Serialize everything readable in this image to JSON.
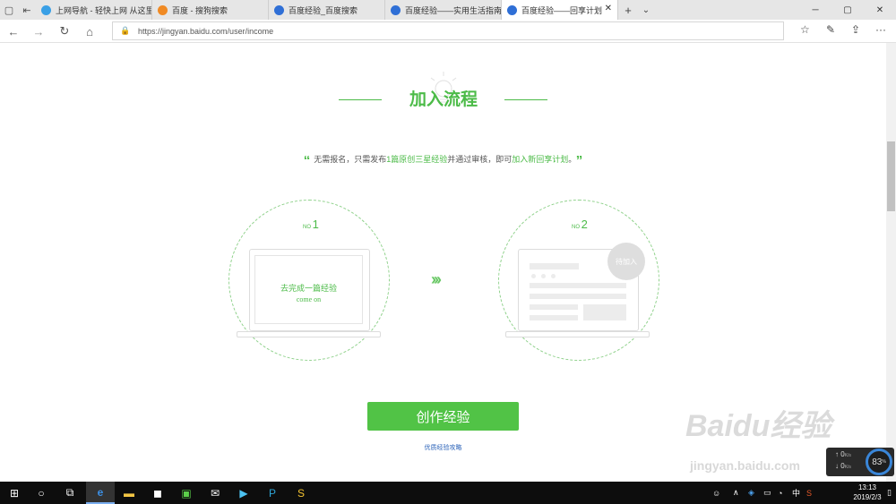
{
  "browser": {
    "tabs": [
      {
        "label": "上网导航 - 轻快上网 从这里",
        "fav": "#3aa0e6"
      },
      {
        "label": "百度 - 搜狗搜索",
        "fav": "#f08a24"
      },
      {
        "label": "百度经验_百度搜索",
        "fav": "#2f6fd6"
      },
      {
        "label": "百度经验——实用生活指南",
        "fav": "#2f6fd6"
      },
      {
        "label": "百度经验——回享计划",
        "fav": "#2f6fd6"
      }
    ],
    "url": "https://jingyan.baidu.com/user/income"
  },
  "page": {
    "section_title": "加入流程",
    "quote_pre": "无需报名，只需发布",
    "quote_hl1": "1篇原创三星经验",
    "quote_mid": "并通过审核，即可",
    "quote_hl2": "加入新回享计划",
    "quote_end": "。",
    "step1": {
      "no_prefix": "NO",
      "no": "1",
      "text": "去完成一篇经验",
      "sub": "come on"
    },
    "step2": {
      "no_prefix": "NO",
      "no": "2",
      "badge": "待加入"
    },
    "create_button": "创作经验",
    "guide_link": "优质经验攻略"
  },
  "watermark": {
    "logo": "Baidu经验",
    "url": "jingyan.baidu.com"
  },
  "net_widget": {
    "up": "0",
    "down": "0",
    "unit": "K/s",
    "percent": "83",
    "percent_unit": "%"
  },
  "taskbar": {
    "ime": "中",
    "time": "13:13",
    "date": "2019/2/3"
  },
  "colors": {
    "accent": "#4cbb48",
    "button": "#51c346",
    "link": "#2a62b8"
  }
}
